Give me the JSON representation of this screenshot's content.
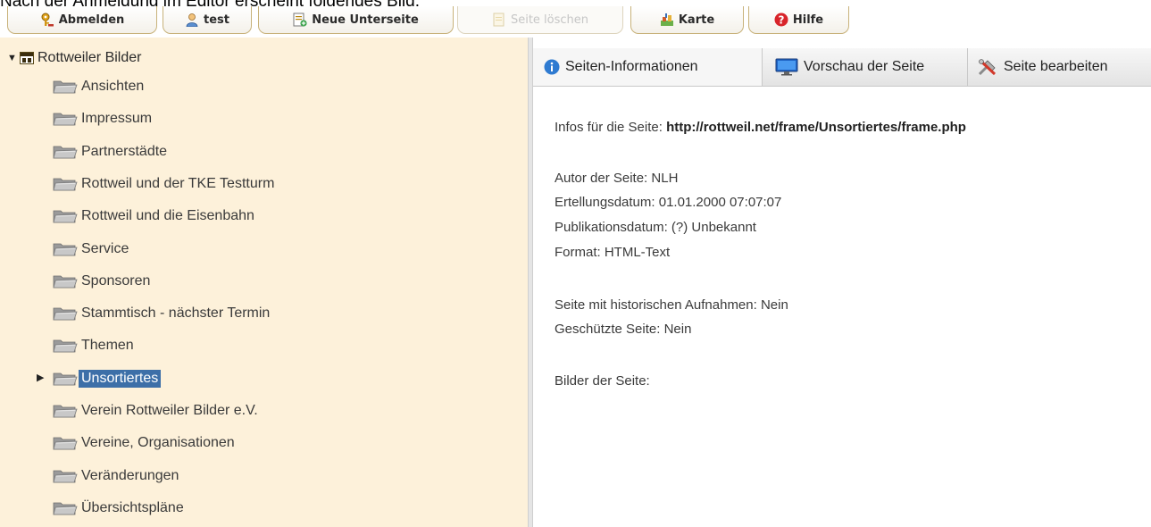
{
  "caption": "Nach der Anmeldung im Editor erscheint folgendes Bild:",
  "toolbar": {
    "logout": "Abmelden",
    "user": "test",
    "new_subpage": "Neue Unterseite",
    "delete_page": "Seite löschen",
    "map": "Karte",
    "help": "Hilfe"
  },
  "tree": {
    "root": "Rottweiler Bilder",
    "items": [
      "Ansichten",
      "Impressum",
      "Partnerstädte",
      "Rottweil und der TKE Testturm",
      "Rottweil und die Eisenbahn",
      "Service",
      "Sponsoren",
      "Stammtisch - nächster Termin",
      "Themen",
      "Unsortiertes",
      "Verein Rottweiler Bilder e.V.",
      "Vereine, Organisationen",
      "Veränderungen",
      "Übersichtspläne"
    ],
    "selected_index": 9
  },
  "tabs": {
    "info": "Seiten-Informationen",
    "preview": "Vorschau der Seite",
    "edit": "Seite bearbeiten"
  },
  "info": {
    "page_label": "Infos für die Seite: ",
    "page_url": "http://rottweil.net/frame/Unsortiertes/frame.php",
    "author": "Autor der Seite: NLH",
    "created": "Ertellungsdatum: 01.01.2000 07:07:07",
    "published": "Publikationsdatum: (?) Unbekannt",
    "format": "Format: HTML-Text",
    "historic": "Seite mit historischen Aufnahmen: Nein",
    "protected": "Geschützte Seite: Nein",
    "images": "Bilder der Seite:"
  },
  "colors": {
    "tree_bg": "#fdf1da",
    "selected_bg": "#3d6fa8",
    "tab_bg": "#e8e8e8"
  }
}
